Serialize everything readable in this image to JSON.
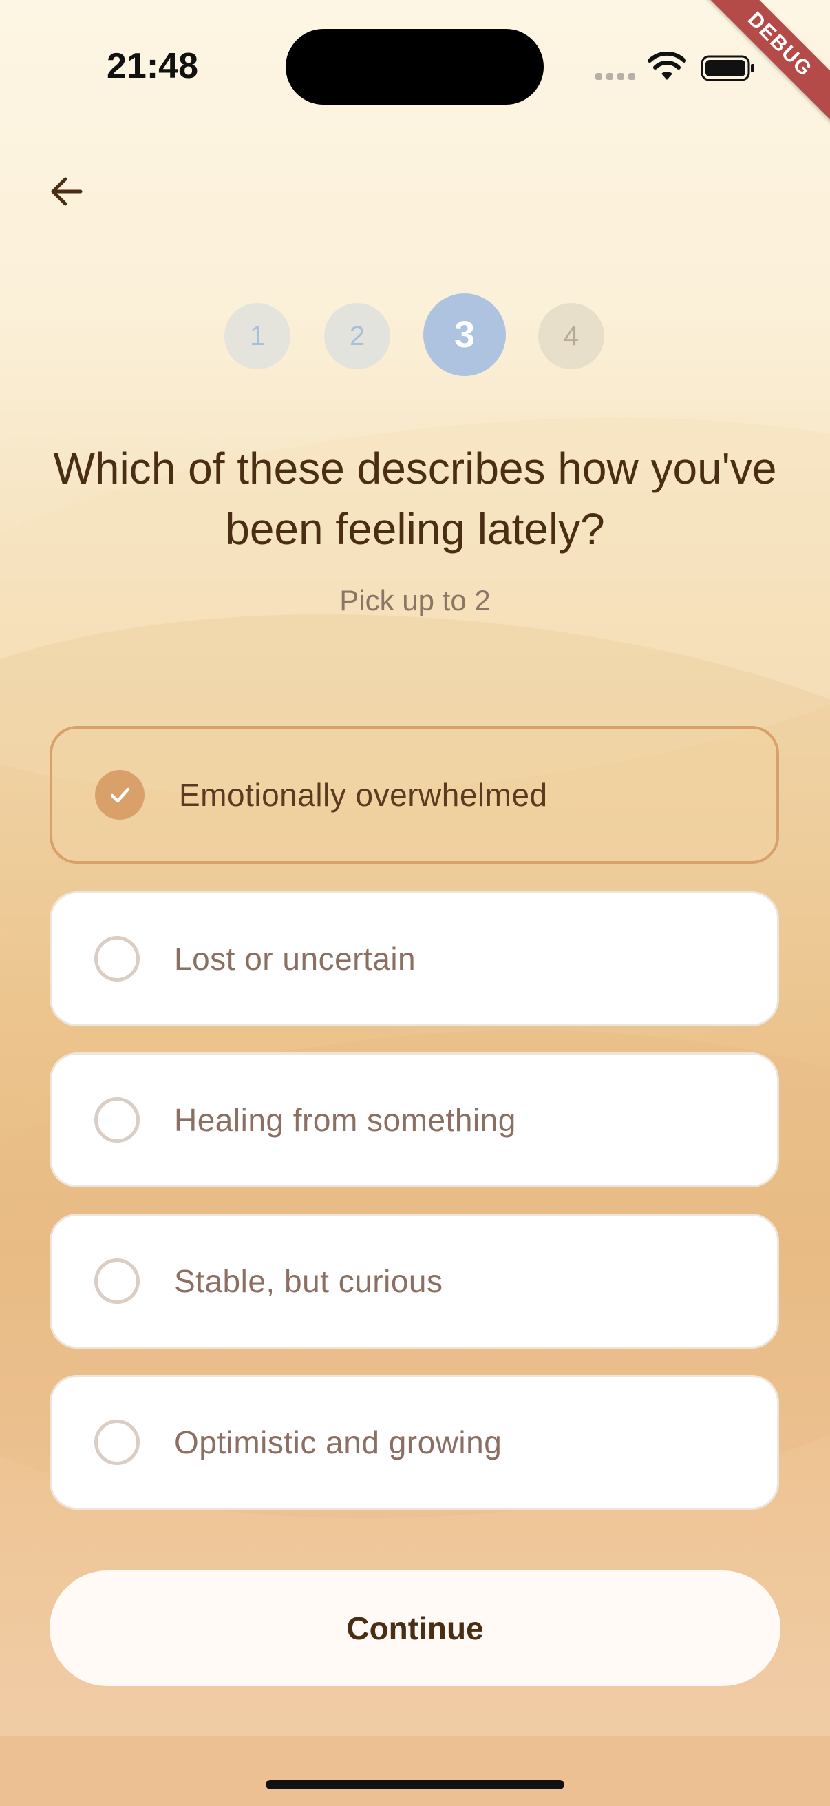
{
  "status_bar": {
    "time": "21:48"
  },
  "debug_banner": "DEBUG",
  "steps": {
    "items": [
      "1",
      "2",
      "3",
      "4"
    ],
    "current": 3
  },
  "question": {
    "title": "Which of these describes how you've been feeling lately?",
    "hint": "Pick up to 2"
  },
  "options": [
    {
      "label": "Emotionally overwhelmed",
      "selected": true
    },
    {
      "label": "Lost or uncertain",
      "selected": false
    },
    {
      "label": "Healing from something",
      "selected": false
    },
    {
      "label": "Stable, but curious",
      "selected": false
    },
    {
      "label": "Optimistic and growing",
      "selected": false
    }
  ],
  "continue_label": "Continue",
  "colors": {
    "accent": "#d9a06a",
    "text_primary": "#4a2e14",
    "step_active": "#aec3e0"
  },
  "icons": {
    "back": "arrow-left-icon",
    "check": "check-icon",
    "wifi": "wifi-icon",
    "battery": "battery-icon"
  }
}
